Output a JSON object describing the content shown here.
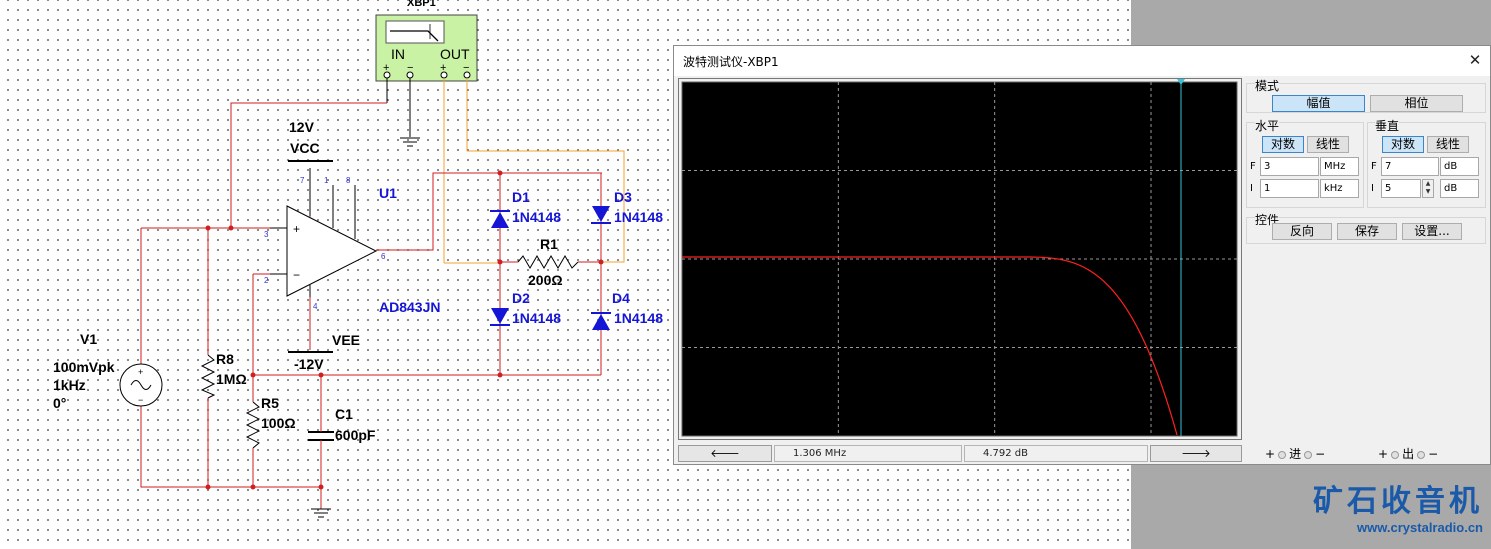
{
  "schematic": {
    "xbp1_label": "XBP1",
    "xbp1_in": "IN",
    "xbp1_out": "OUT",
    "plus": "+",
    "minus": "−",
    "vcc_value": "12V",
    "vcc_name": "VCC",
    "vee_name": "VEE",
    "vee_value": "-12V",
    "u1_name": "U1",
    "u1_part": "AD843JN",
    "pins": [
      "7",
      "1",
      "8",
      "3",
      "2",
      "6",
      "4"
    ],
    "d1": {
      "name": "D1",
      "part": "1N4148"
    },
    "d2": {
      "name": "D2",
      "part": "1N4148"
    },
    "d3": {
      "name": "D3",
      "part": "1N4148"
    },
    "d4": {
      "name": "D4",
      "part": "1N4148"
    },
    "r1": {
      "name": "R1",
      "value": "200Ω"
    },
    "r5": {
      "name": "R5",
      "value": "100Ω"
    },
    "r8": {
      "name": "R8",
      "value": "1MΩ"
    },
    "c1": {
      "name": "C1",
      "value": "600pF"
    },
    "v1": {
      "name": "V1",
      "amp": "100mVpk",
      "freq": "1kHz",
      "phase": "0°"
    }
  },
  "bode": {
    "title": "波特测试仪-XBP1",
    "close": "✕",
    "trace_color": "#ff2020",
    "cursor_color": "#39c3d6",
    "plot_background": "#000000",
    "status": {
      "left_arrow": "🡐",
      "right_arrow": "🡒",
      "freq": "1.306 MHz",
      "gain": "4.792 dB"
    },
    "mode": {
      "label": "模式",
      "magnitude": "幅值",
      "phase": "相位"
    },
    "horizontal": {
      "label": "水平",
      "log": "对数",
      "lin": "线性",
      "f_label": "F",
      "f_value": "3",
      "f_unit": "MHz",
      "i_label": "I",
      "i_value": "1",
      "i_unit": "kHz"
    },
    "vertical": {
      "label": "垂直",
      "log": "对数",
      "lin": "线性",
      "f_label": "F",
      "f_value": "7",
      "f_unit": "dB",
      "i_label": "I",
      "i_value": "5",
      "i_unit": "dB"
    },
    "controls": {
      "label": "控件",
      "reverse": "反向",
      "save": "保存",
      "settings": "设置..."
    },
    "terminals": {
      "plus": "+",
      "minus": "−",
      "in": "进",
      "out": "出"
    }
  },
  "watermark": {
    "title": "矿石收音机",
    "url": "www.crystalradio.cn"
  }
}
